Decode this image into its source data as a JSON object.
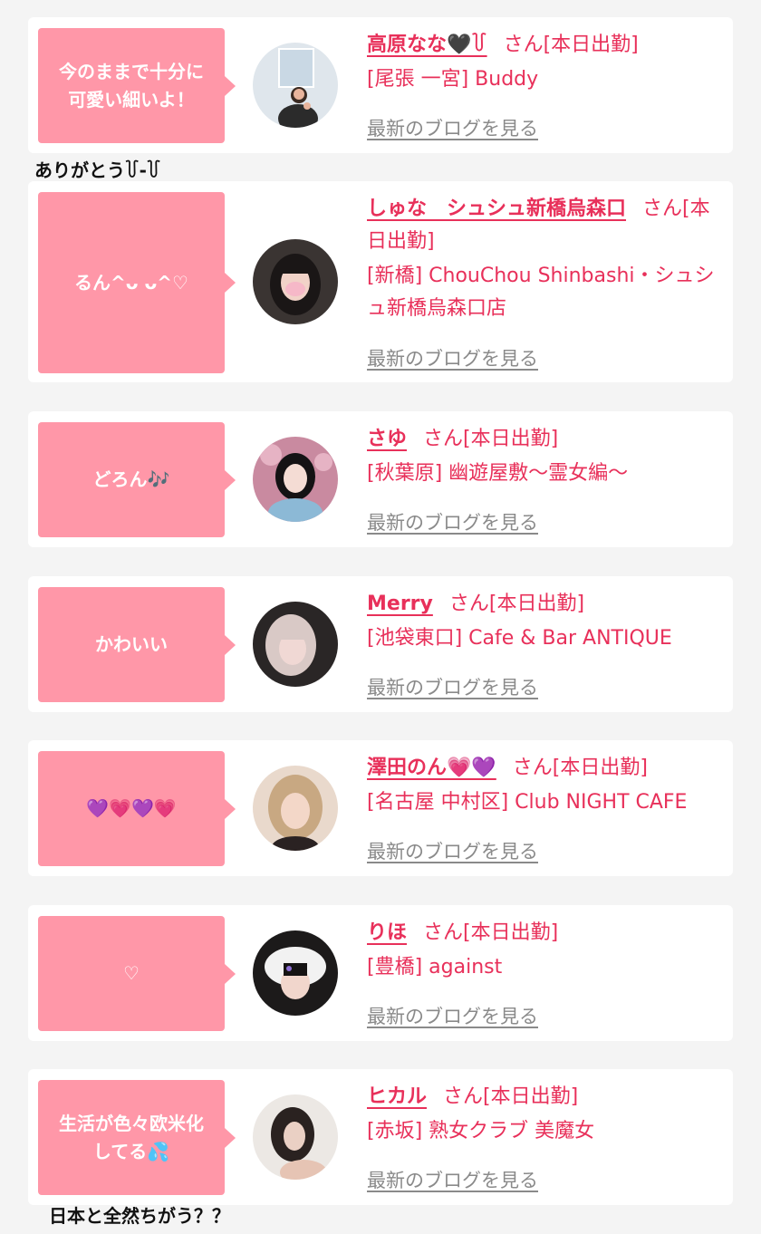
{
  "colors": {
    "accent": "#e8305a",
    "bubble": "#ff97a8",
    "background": "#f4f4f4",
    "card": "#ffffff"
  },
  "captions": {
    "top": "ありがとう꒦-꒦",
    "bottom": "日本と全然ちがう？？"
  },
  "cards": [
    {
      "comment": "今のままで十分に\n可愛い細いよ！",
      "name": "高原なな🖤꒦",
      "suffix": "さん[本日出勤]",
      "shop": "[尾張 一宮] Buddy",
      "blog_link": "最新のブログを見る"
    },
    {
      "comment": "るん^ᴗ ᴗ^♡",
      "name": "しゅな　シュシュ新橋烏森口",
      "suffix": "さん[本日出勤]",
      "shop": "[新橋] ChouChou Shinbashi・シュシュ新橋烏森口店",
      "blog_link": "最新のブログを見る"
    },
    {
      "comment": "どろん🎶",
      "name": "さゆ",
      "suffix": "さん[本日出勤]",
      "shop": "[秋葉原] 幽遊屋敷～霊女編～",
      "blog_link": "最新のブログを見る"
    },
    {
      "comment": "かわいい",
      "name": "Merry",
      "suffix": "さん[本日出勤]",
      "shop": "[池袋東口] Cafe & Bar ANTIQUE",
      "blog_link": "最新のブログを見る"
    },
    {
      "comment": "💜💗💜💗",
      "name": "澤田のん💗💜",
      "suffix": "さん[本日出勤]",
      "shop": "[名古屋 中村区] Club NIGHT CAFE",
      "blog_link": "最新のブログを見る"
    },
    {
      "comment": "♡",
      "name": "りほ",
      "suffix": "さん[本日出勤]",
      "shop": "[豊橋] against",
      "blog_link": "最新のブログを見る"
    },
    {
      "comment": "生活が色々欧米化\nしてる💦",
      "name": "ヒカル",
      "suffix": "さん[本日出勤]",
      "shop": "[赤坂] 熟女クラブ 美魔女",
      "blog_link": "最新のブログを見る"
    }
  ]
}
